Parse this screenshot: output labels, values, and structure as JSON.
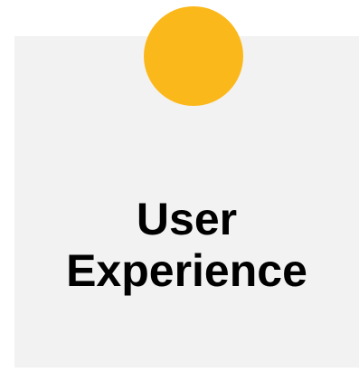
{
  "card": {
    "title_line1": "User",
    "title_line2": "Experience"
  },
  "colors": {
    "card_background": "#f2f2f2",
    "pin": "#fbb81b",
    "text": "#000000"
  }
}
